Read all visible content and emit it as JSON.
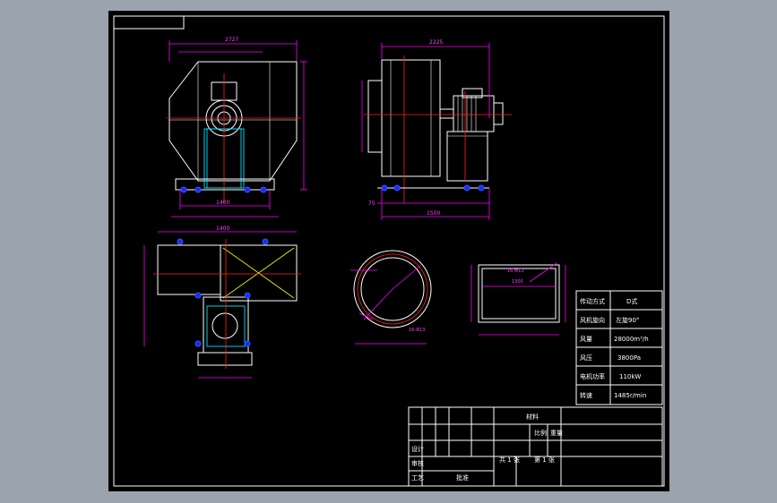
{
  "front_view": {
    "dim_overall_width": "2727",
    "dim_base_width": "1400"
  },
  "side_view": {
    "dim_overall_width": "2225",
    "dim_base_width": "1500",
    "dim_left": "75"
  },
  "top_view": {
    "dim_top": "1400"
  },
  "section_views": {
    "inlet_bolt_note": "16-Φ13",
    "outlet_bolt_note": "16-Φ13",
    "outlet_dim": "1300"
  },
  "spec_table": {
    "rows": [
      {
        "label": "传动方式",
        "value": "D式"
      },
      {
        "label": "风机旋向",
        "value": "左旋90°"
      },
      {
        "label": "风量",
        "value": "28000m³/h"
      },
      {
        "label": "风压",
        "value": "3800Pa"
      },
      {
        "label": "电机功率",
        "value": "110kW"
      },
      {
        "label": "转速",
        "value": "1485r/min"
      }
    ]
  },
  "title_block": {
    "scale_label": "比例",
    "weight_label": "重量",
    "sheet_label": "共 1 张",
    "sheet_of_label": "第 1 张",
    "designer_label": "设计",
    "checker_label": "审核",
    "process_label": "工艺",
    "approve_label": "批准",
    "material_label": "材料"
  }
}
